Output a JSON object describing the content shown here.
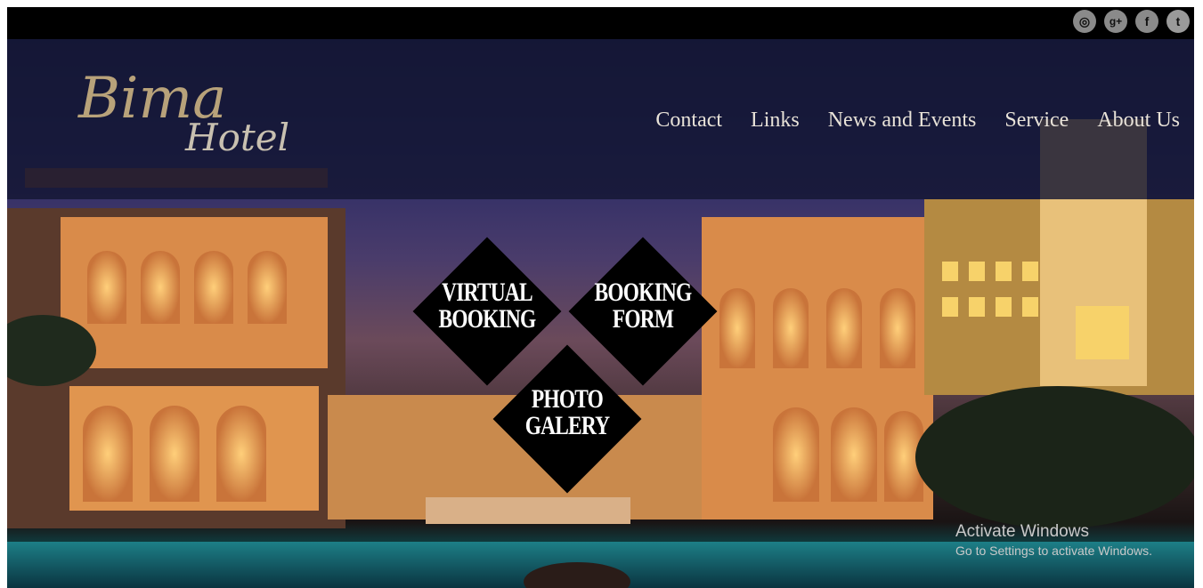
{
  "social": {
    "instagram_glyph": "◎",
    "googleplus_glyph": "g+",
    "facebook_glyph": "f",
    "twitter_glyph": "t"
  },
  "logo": {
    "line1": "Bima",
    "line2": "Hotel"
  },
  "nav": {
    "contact": "Contact",
    "links": "Links",
    "news": "News and Events",
    "service": "Service",
    "about": "About Us"
  },
  "tiles": {
    "virtual_line1": "VIRTUAL",
    "virtual_line2": "BOOKING",
    "booking_line1": "BOOKING",
    "booking_line2": "FORM",
    "photo_line1": "PHOTO",
    "photo_line2": "GALERY"
  },
  "watermark": {
    "title": "Activate Windows",
    "subtitle": "Go to Settings to activate Windows."
  },
  "colors": {
    "nav_text": "#e8e2d8",
    "logo_gold": "#b8a27a",
    "topbar": "#000000"
  }
}
